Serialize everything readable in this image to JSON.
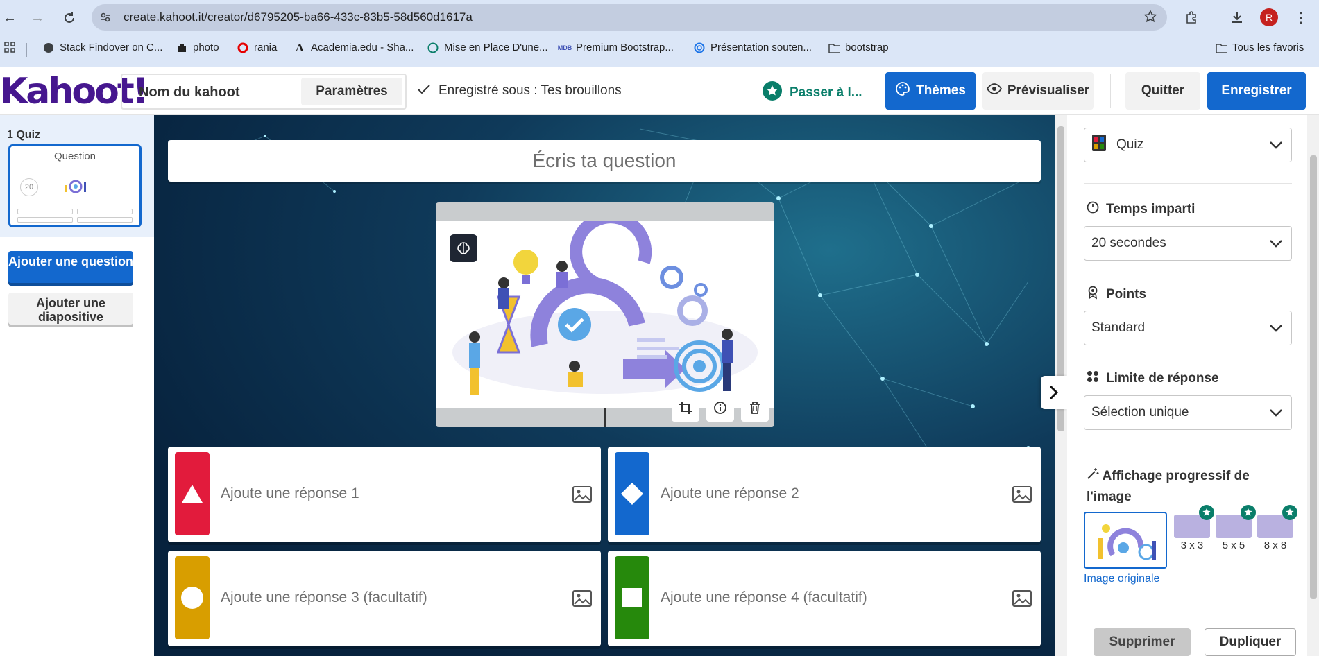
{
  "browser": {
    "url": "create.kahoot.it/creator/d6795205-ba66-433c-83b5-58d560d1617a",
    "profile_initial": "R",
    "bookmarks": [
      {
        "label": "Stack Findover on C..."
      },
      {
        "label": "photo"
      },
      {
        "label": "rania"
      },
      {
        "label": "Academia.edu - Sha..."
      },
      {
        "label": "Mise en Place D'une..."
      },
      {
        "label": "Premium Bootstrap..."
      },
      {
        "label": "Présentation souten..."
      },
      {
        "label": "bootstrap"
      }
    ],
    "all_bookmarks": "Tous les favoris"
  },
  "header": {
    "logo": "Kahoot!",
    "title_placeholder": "Nom du kahoot",
    "settings_label": "Paramètres",
    "saved_status": "Enregistré sous : Tes brouillons",
    "upgrade_label": "Passer à l...",
    "themes_label": "Thèmes",
    "preview_label": "Prévisualiser",
    "quit_label": "Quitter",
    "save_label": "Enregistrer"
  },
  "sidebar": {
    "slide_label": "1  Quiz",
    "thumb_title": "Question",
    "thumb_timer": "20",
    "add_question": "Ajouter une question",
    "add_slide": "Ajouter une diapositive"
  },
  "editor": {
    "question_placeholder": "Écris ta question",
    "answers": [
      {
        "placeholder": "Ajoute une réponse 1",
        "color": "#e21b3c",
        "shape": "triangle"
      },
      {
        "placeholder": "Ajoute une réponse 2",
        "color": "#1368ce",
        "shape": "diamond"
      },
      {
        "placeholder": "Ajoute une réponse 3 (facultatif)",
        "color": "#d89e00",
        "shape": "circle"
      },
      {
        "placeholder": "Ajoute une réponse 4 (facultatif)",
        "color": "#26890c",
        "shape": "square"
      }
    ]
  },
  "settings": {
    "question_type": "Quiz",
    "time_title": "Temps imparti",
    "time_value": "20 secondes",
    "points_title": "Points",
    "points_value": "Standard",
    "limit_title": "Limite de réponse",
    "limit_value": "Sélection unique",
    "reveal_title": "Affichage progressif de l'image",
    "reveal_options": [
      "3 x 3",
      "5 x 5",
      "8 x 8"
    ],
    "original_image": "Image originale",
    "delete_label": "Supprimer",
    "duplicate_label": "Dupliquer"
  },
  "colors": {
    "brand_purple": "#46178f",
    "primary_blue": "#1368ce",
    "upgrade_green": "#0a7e6a"
  }
}
